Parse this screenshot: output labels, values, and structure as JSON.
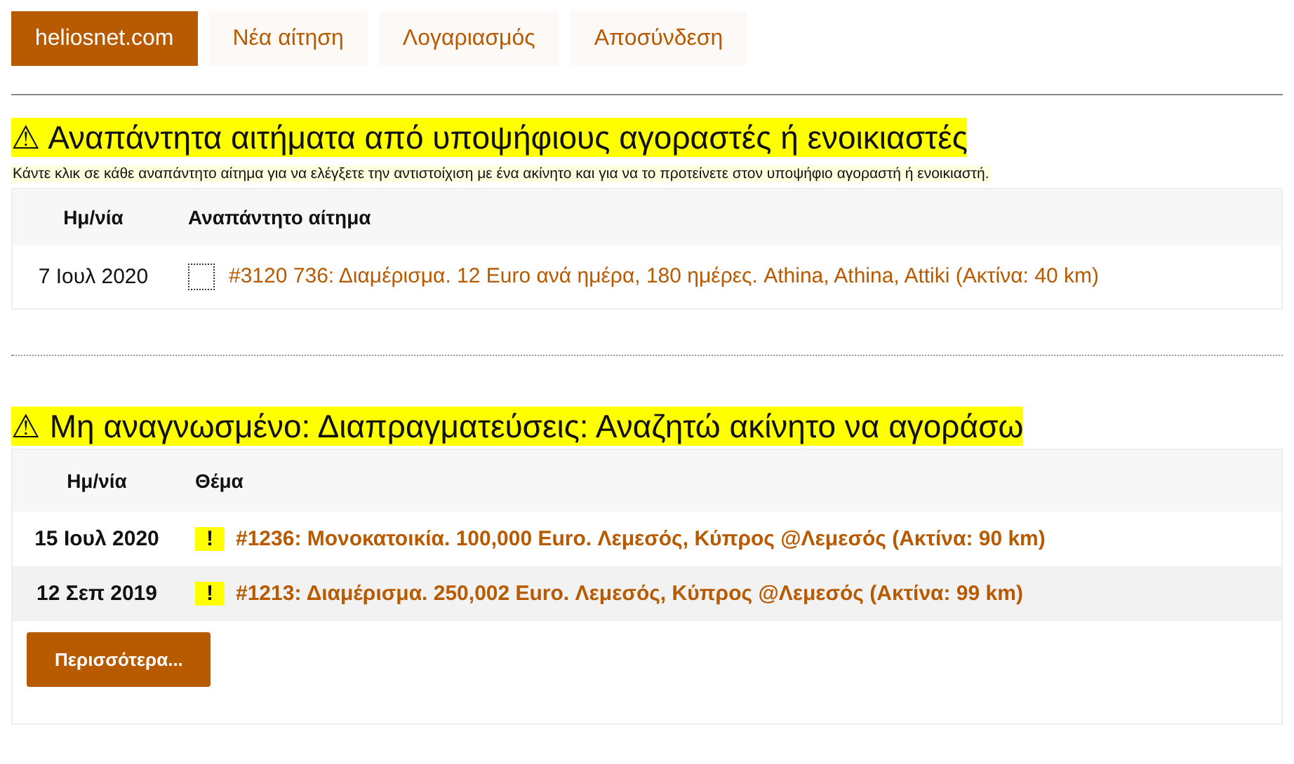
{
  "nav": [
    {
      "label": "heliosnet.com",
      "selected": true
    },
    {
      "label": "Νέα αίτηση",
      "selected": false
    },
    {
      "label": "Λογαριασμός",
      "selected": false
    },
    {
      "label": "Αποσύνδεση",
      "selected": false
    }
  ],
  "sections": [
    {
      "warning_icon": "⚠",
      "title": "Αναπάντητα αιτήματα από υποψήφιους αγοραστές ή ενοικιαστές",
      "note": "Κάντε κλικ σε κάθε αναπάντητο αίτημα για να ελέγξετε την αντιστοίχιση με ένα ακίνητο και για να το προτείνετε στον υποψήφιο αγοραστή ή ενοικιαστή.",
      "columns": [
        "Ημ/νία",
        "Αναπάντητο αίτημα"
      ],
      "rows": [
        {
          "kind": "checkbox",
          "date": "7 Ιουλ 2020",
          "checked": false,
          "link": "#3120 736: Διαμέρισμα. 12 Euro ανά ημέρα, 180 ημέρες. Athina, Athina, Attiki (Ακτίνα:  40 km)",
          "unread": false
        }
      ]
    },
    {
      "warning_icon": "⚠",
      "title": "Μη αναγνωσμένο: Διαπραγματεύσεις: Αναζητώ ακίνητο να αγοράσω",
      "columns": [
        "Ημ/νία",
        "Θέμα"
      ],
      "rows": [
        {
          "kind": "flag",
          "date": "15 Ιουλ 2020",
          "flag": "!",
          "link": "#1236: Μονοκατοικία. 100,000 Euro. Λεμεσός, Κύπρος @Λεμεσός (Ακτίνα:  90 km)",
          "unread": true
        },
        {
          "kind": "flag",
          "date": "12 Σεπ 2019",
          "flag": "!",
          "link": "#1213: Διαμέρισμα. 250,002 Euro. Λεμεσός, Κύπρος @Λεμεσός (Ακτίνα:  99 km)",
          "unread": true
        }
      ],
      "more_button": "Περισσότερα..."
    }
  ]
}
